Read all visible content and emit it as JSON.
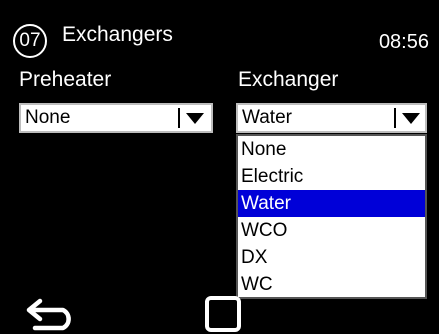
{
  "header": {
    "screen_number": "07",
    "title": "Exchangers",
    "time": "08:56"
  },
  "preheater": {
    "label": "Preheater",
    "value": "None"
  },
  "exchanger": {
    "label": "Exchanger",
    "value": "Water",
    "options": [
      "None",
      "Electric",
      "Water",
      "WCO",
      "DX",
      "WC"
    ],
    "selected_index": 2
  },
  "colors": {
    "background": "#000000",
    "selection": "#0000d8",
    "field": "#ffffff"
  },
  "icons": {
    "back": "back-arrow-icon",
    "home": "square-home-icon",
    "combo_arrow": "triangle-down-icon"
  }
}
